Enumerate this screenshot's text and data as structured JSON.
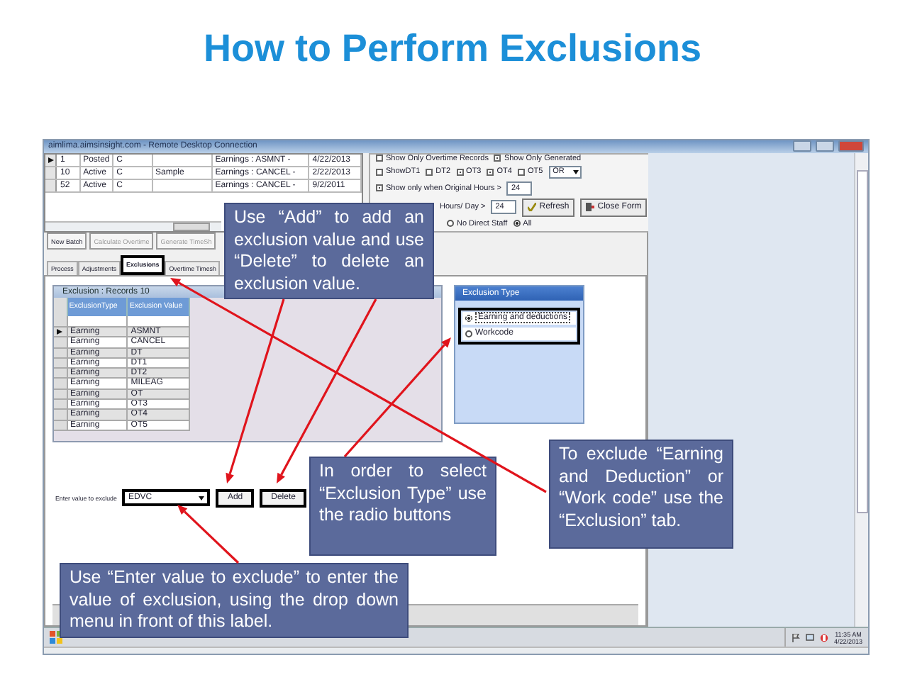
{
  "slide_title": "How to Perform Exclusions",
  "window": {
    "title": "aimlima.aimsinsight.com - Remote Desktop Connection"
  },
  "batch_grid": {
    "rows": [
      {
        "selected": true,
        "cells": [
          "1",
          "Posted",
          "C",
          "",
          "Earnings : ASMNT -",
          "4/22/2013"
        ]
      },
      {
        "selected": false,
        "cells": [
          "10",
          "Active",
          "C",
          "Sample",
          "Earnings : CANCEL -",
          "2/22/2013"
        ]
      },
      {
        "selected": false,
        "cells": [
          "52",
          "Active",
          "C",
          "",
          "Earnings : CANCEL -",
          "9/2/2011"
        ]
      }
    ]
  },
  "batch_buttons": [
    {
      "label": "New Batch",
      "disabled": false
    },
    {
      "label": "Calculate Overtime",
      "disabled": true
    },
    {
      "label": "Generate TimeSh",
      "disabled": true
    }
  ],
  "options": {
    "top_checks": [
      {
        "label": "Show Only Overtime Records",
        "checked": false
      },
      {
        "label": "Show Only Generated",
        "checked": true
      }
    ],
    "checks": [
      {
        "label": "ShowDT1",
        "checked": false
      },
      {
        "label": "DT2",
        "checked": false
      },
      {
        "label": "OT3",
        "checked": true
      },
      {
        "label": "OT4",
        "checked": true
      },
      {
        "label": "OT5",
        "checked": false
      }
    ],
    "operator": "OR",
    "hours_check": {
      "label": "Show only when Original Hours >",
      "checked": true,
      "value": "24"
    },
    "day_label": "Hours/ Day >",
    "day_value": "24",
    "buttons": [
      "Refresh",
      "Close Form"
    ],
    "radios": [
      {
        "label": "No Direct Staff",
        "selected": false
      },
      {
        "label": "All",
        "selected": true
      }
    ]
  },
  "tabs": [
    {
      "label": "Process",
      "selected": false
    },
    {
      "label": "Adjustments",
      "selected": false
    },
    {
      "label": "Exclusions",
      "selected": true
    },
    {
      "label": "Overtime Timesh",
      "selected": false
    }
  ],
  "exclusion_panel": {
    "title": "Exclusion : Records 10",
    "columns": [
      "ExclusionType",
      "Exclusion Value"
    ],
    "rows": [
      {
        "selected": true,
        "cells": [
          "Earning",
          "ASMNT"
        ]
      },
      {
        "selected": false,
        "cells": [
          "Earning",
          "CANCEL"
        ]
      },
      {
        "selected": false,
        "cells": [
          "Earning",
          "DT"
        ]
      },
      {
        "selected": false,
        "cells": [
          "Earning",
          "DT1"
        ]
      },
      {
        "selected": false,
        "cells": [
          "Earning",
          "DT2"
        ]
      },
      {
        "selected": false,
        "cells": [
          "Earning",
          "MILEAG"
        ]
      },
      {
        "selected": false,
        "cells": [
          "Earning",
          "OT"
        ]
      },
      {
        "selected": false,
        "cells": [
          "Earning",
          "OT3"
        ]
      },
      {
        "selected": false,
        "cells": [
          "Earning",
          "OT4"
        ]
      },
      {
        "selected": false,
        "cells": [
          "Earning",
          "OT5"
        ]
      }
    ]
  },
  "exclusion_type": {
    "title": "Exclusion Type",
    "options": [
      {
        "label": "Earning and deductions",
        "selected": true
      },
      {
        "label": "Workcode",
        "selected": false
      }
    ]
  },
  "exclude_row": {
    "label": "Enter value to exclude",
    "value": "EDVC",
    "buttons": [
      "Add",
      "Delete"
    ]
  },
  "tray": {
    "time": "11:35 AM",
    "date": "4/22/2013"
  },
  "callouts": [
    {
      "text": "Use “Add” to add an exclusion value and use “Delete” to delete an exclusion value."
    },
    {
      "text": "In order to select “Exclusion Type” use the radio buttons"
    },
    {
      "text": "To exclude “Earning and Deduction” or “Work code” use the “Exclusion” tab."
    },
    {
      "text": "Use “Enter value to exclude” to enter the value of exclusion, using the drop down menu in front of this label."
    }
  ]
}
